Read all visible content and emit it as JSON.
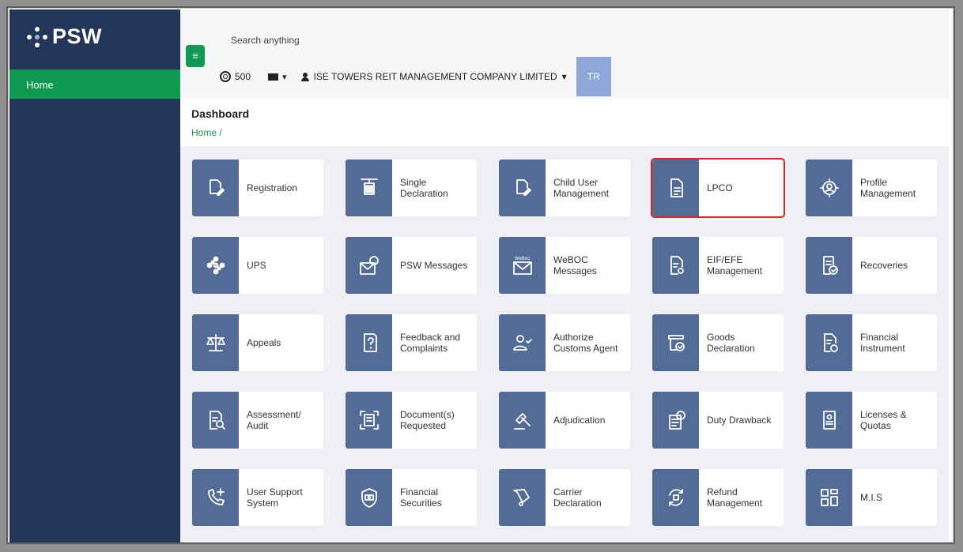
{
  "app": {
    "logo_text": "PSW"
  },
  "sidebar": {
    "items": [
      {
        "label": "Home",
        "active": true
      }
    ]
  },
  "topbar": {
    "search_placeholder": "Search anything",
    "coins": "500",
    "company": "ISE TOWERS REIT MANAGEMENT COMPANY LIMITED",
    "avatar_initials": "TR"
  },
  "header": {
    "title": "Dashboard",
    "breadcrumb": "Home /"
  },
  "colors": {
    "accent": "#0f9a53",
    "sidebar": "#23365a",
    "tile": "#536b97",
    "highlight": "#e32323"
  },
  "tiles": [
    {
      "label": "Registration",
      "icon": "edit-document-icon"
    },
    {
      "label": "Single Declaration",
      "icon": "container-crane-icon"
    },
    {
      "label": "Child User Management",
      "icon": "edit-document-icon"
    },
    {
      "label": "LPCO",
      "icon": "document-icon",
      "selected": true
    },
    {
      "label": "Profile Management",
      "icon": "profile-gear-icon"
    },
    {
      "label": "UPS",
      "icon": "psw-dots-icon"
    },
    {
      "label": "PSW Messages",
      "icon": "envelope-badge-icon"
    },
    {
      "label": "WeBOC Messages",
      "icon": "weboc-envelope-icon"
    },
    {
      "label": "EIF/EFE Management",
      "icon": "document-gear-icon"
    },
    {
      "label": "Recoveries",
      "icon": "document-check-icon"
    },
    {
      "label": "Appeals",
      "icon": "scales-icon"
    },
    {
      "label": "Feedback and Complaints",
      "icon": "question-document-icon"
    },
    {
      "label": "Authorize Customs Agent",
      "icon": "user-check-icon"
    },
    {
      "label": "Goods Declaration",
      "icon": "box-check-icon"
    },
    {
      "label": "Financial Instrument",
      "icon": "document-rupee-icon"
    },
    {
      "label": "Assessment/ Audit",
      "icon": "document-search-icon"
    },
    {
      "label": "Document(s) Requested",
      "icon": "scan-document-icon"
    },
    {
      "label": "Adjudication",
      "icon": "gavel-icon"
    },
    {
      "label": "Duty Drawback",
      "icon": "receipt-rupee-icon"
    },
    {
      "label": "Licenses & Quotas",
      "icon": "id-card-icon"
    },
    {
      "label": "User Support System",
      "icon": "phone-plus-icon"
    },
    {
      "label": "Financial Securities",
      "icon": "shield-money-icon"
    },
    {
      "label": "Carrier Declaration",
      "icon": "cart-icon"
    },
    {
      "label": "Refund Management",
      "icon": "refund-cycle-icon"
    },
    {
      "label": "M.I.S",
      "icon": "dashboard-grid-icon"
    }
  ]
}
